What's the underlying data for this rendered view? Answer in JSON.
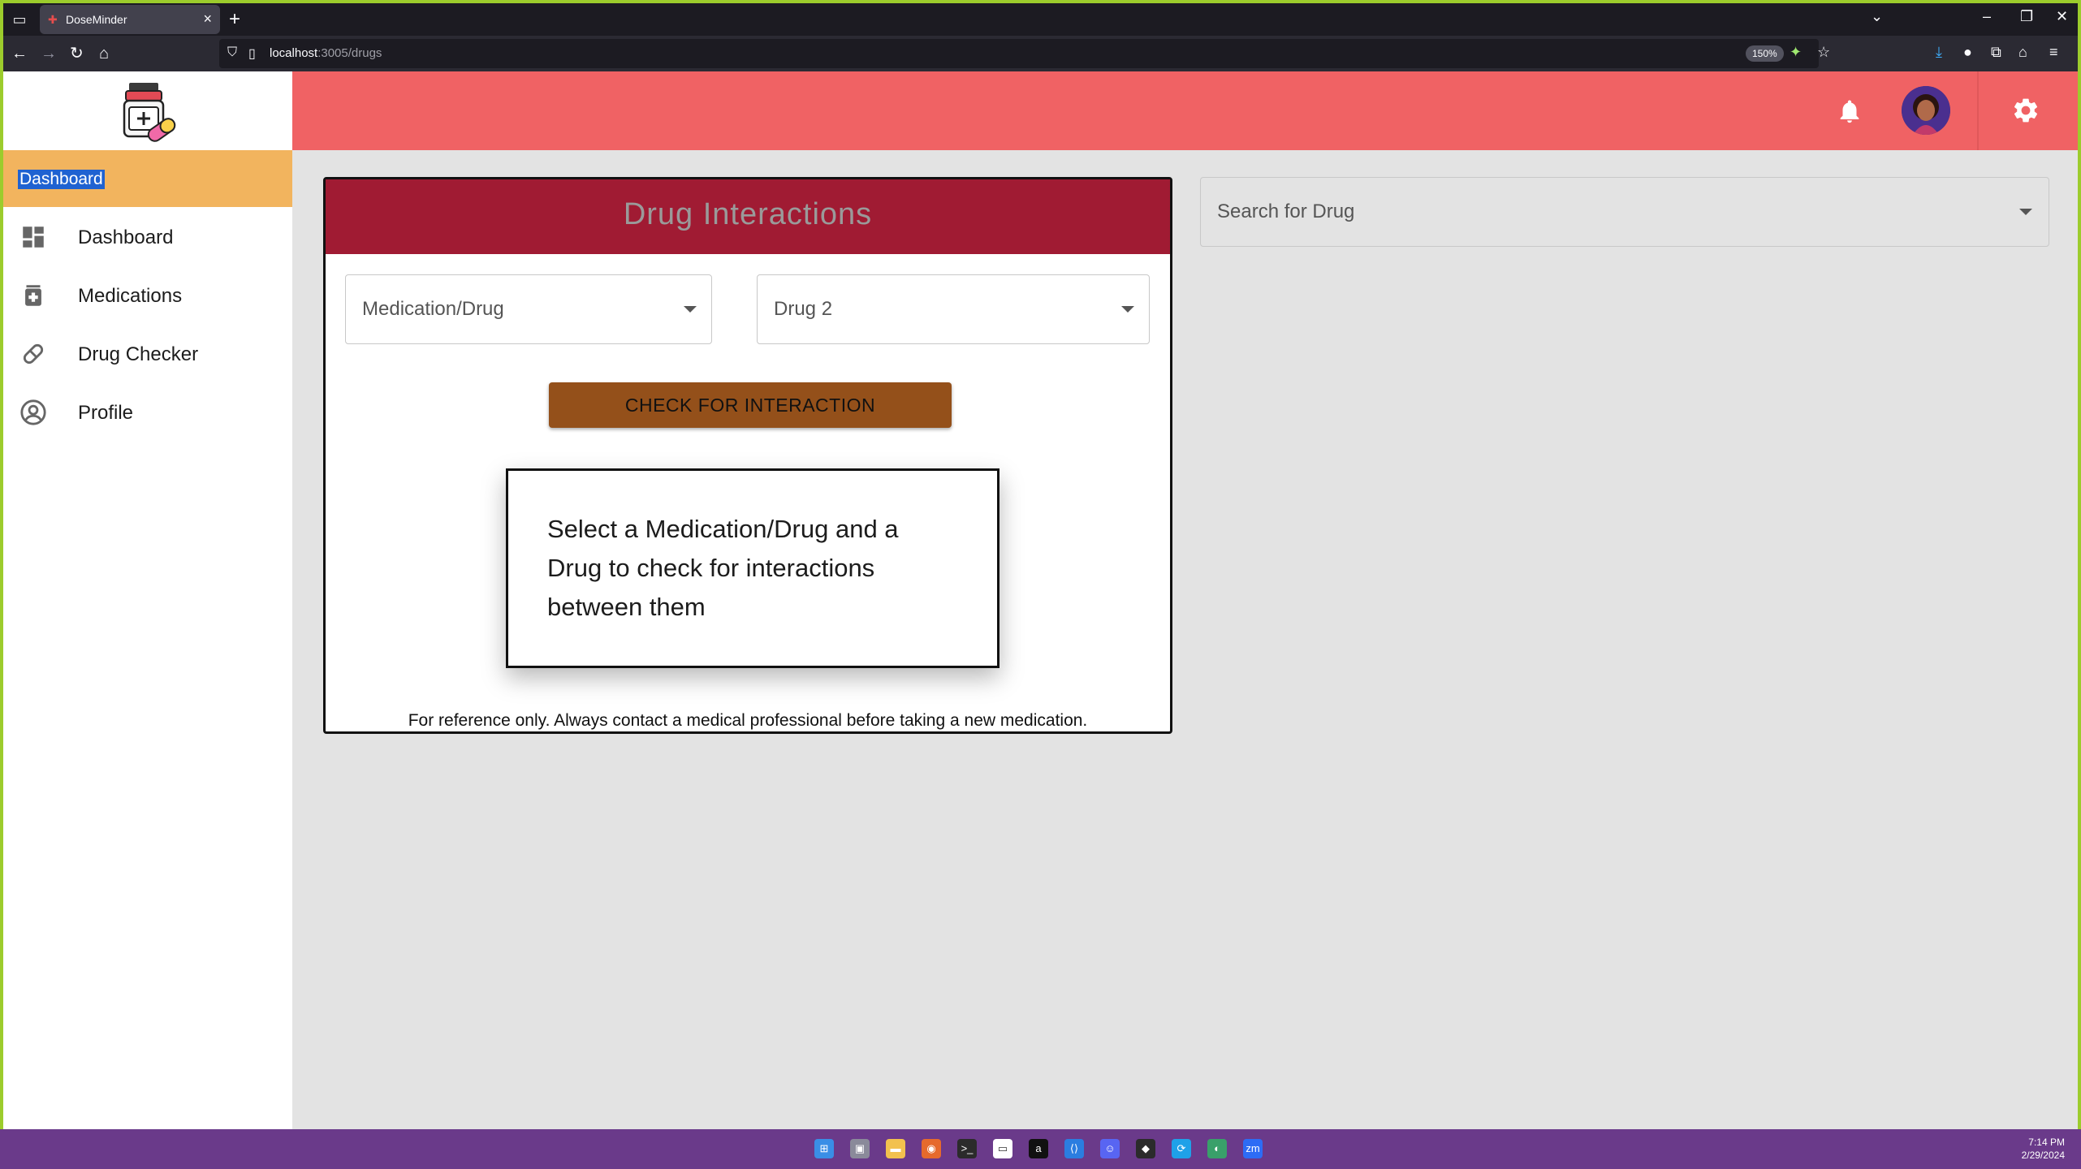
{
  "browser": {
    "tab_title": "DoseMinder",
    "tab_close": "×",
    "new_tab": "+",
    "url_host": "localhost",
    "url_path": ":3005/drugs",
    "zoom": "150%"
  },
  "header": {
    "bell_icon": "bell-icon",
    "settings_icon": "gear-icon"
  },
  "sidebar": {
    "section_title": "Dashboard",
    "items": [
      {
        "label": "Dashboard",
        "icon": "dashboard-icon"
      },
      {
        "label": "Medications",
        "icon": "medication-icon"
      },
      {
        "label": "Drug Checker",
        "icon": "pill-icon"
      },
      {
        "label": "Profile",
        "icon": "profile-icon"
      }
    ]
  },
  "main": {
    "title": "Drug Interactions",
    "select1_placeholder": "Medication/Drug",
    "select2_placeholder": "Drug 2",
    "check_button": "CHECK FOR INTERACTION",
    "message": "Select a Medication/Drug and a Drug to check for interactions between them",
    "disclaimer": "For reference only. Always contact a medical professional before taking a new medication."
  },
  "search": {
    "placeholder": "Search for Drug"
  },
  "taskbar": {
    "time": "7:14 PM",
    "date": "2/29/2024"
  },
  "colors": {
    "header": "#f06264",
    "card_header": "#a01b33",
    "button": "#94501a",
    "sidebar_section": "#f2b45e",
    "taskbar": "#6a3a8a"
  }
}
